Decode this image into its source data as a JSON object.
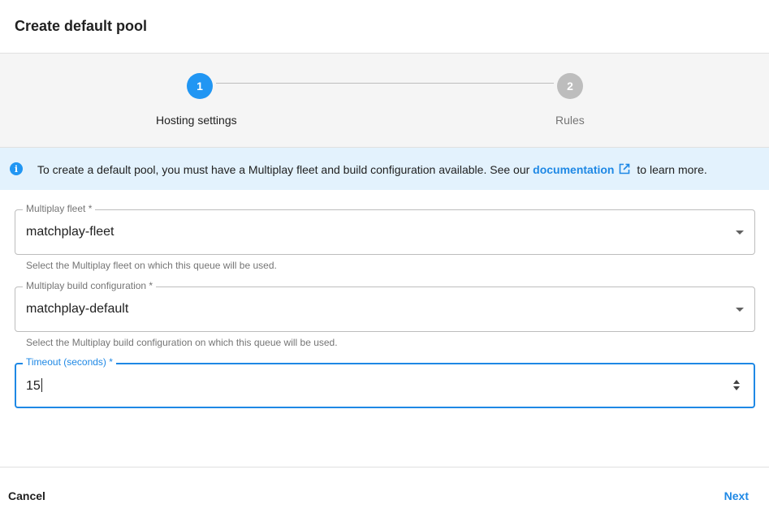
{
  "dialog": {
    "title": "Create default pool"
  },
  "stepper": {
    "steps": [
      {
        "number": "1",
        "label": "Hosting settings",
        "active": true
      },
      {
        "number": "2",
        "label": "Rules",
        "active": false
      }
    ]
  },
  "info": {
    "text_before": "To create a default pool, you must have a Multiplay fleet and build configuration available. See our ",
    "link_text": "documentation",
    "text_after": " to learn more.",
    "icon": "info-icon",
    "link_icon": "external-link-icon"
  },
  "form": {
    "fleet": {
      "label": "Multiplay fleet *",
      "value": "matchplay-fleet",
      "helper": "Select the Multiplay fleet on which this queue will be used."
    },
    "build_config": {
      "label": "Multiplay build configuration *",
      "value": "matchplay-default",
      "helper": "Select the Multiplay build configuration on which this queue will be used."
    },
    "timeout": {
      "label": "Timeout (seconds) *",
      "value": "15"
    }
  },
  "footer": {
    "cancel_label": "Cancel",
    "next_label": "Next"
  },
  "colors": {
    "accent": "#2196f3",
    "link": "#1e88e5",
    "info_background": "#e3f2fd",
    "stepper_background": "#f5f5f5",
    "inactive_step": "#bdbdbd"
  }
}
